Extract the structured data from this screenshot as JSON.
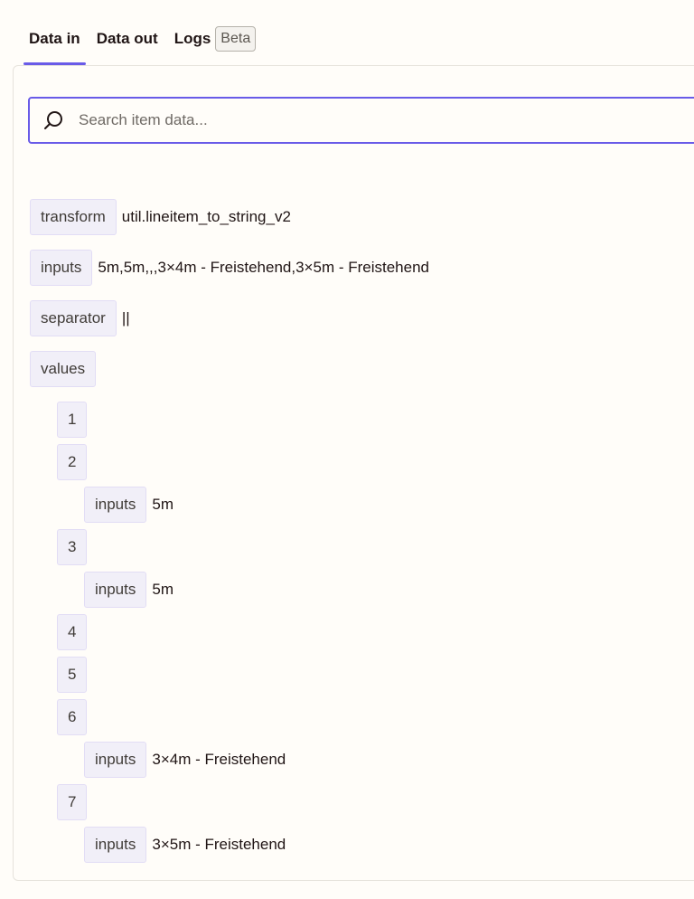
{
  "tabs": {
    "data_in": "Data in",
    "data_out": "Data out",
    "logs": "Logs",
    "logs_badge": "Beta"
  },
  "search": {
    "placeholder": "Search item data..."
  },
  "fields": {
    "transform": {
      "key": "transform",
      "value": "util.lineitem_to_string_v2"
    },
    "inputs": {
      "key": "inputs",
      "value": "5m,5m,,,3×4m - Freistehend,3×5m - Freistehend"
    },
    "separator": {
      "key": "separator",
      "value": "||"
    },
    "values": {
      "key": "values"
    }
  },
  "values_items": [
    {
      "index": "1"
    },
    {
      "index": "2",
      "child_key": "inputs",
      "child_value": "5m"
    },
    {
      "index": "3",
      "child_key": "inputs",
      "child_value": "5m"
    },
    {
      "index": "4"
    },
    {
      "index": "5"
    },
    {
      "index": "6",
      "child_key": "inputs",
      "child_value": "3×4m - Freistehend"
    },
    {
      "index": "7",
      "child_key": "inputs",
      "child_value": "3×5m - Freistehend"
    }
  ],
  "colors": {
    "accent": "#695be8",
    "key_bg": "#f1eff8",
    "background": "#fffdf9"
  }
}
